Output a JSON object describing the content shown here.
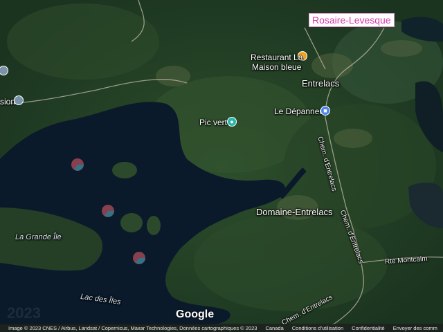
{
  "places": {
    "rosaire": "Rosaire-Levesque",
    "restaurant": "Restaurant La\nMaison bleue",
    "entrelacs": "Entrelacs",
    "depanneur": "Le Dépanneur",
    "picvert": "Pic vert",
    "domaine": "Domaine-Entrelacs",
    "grande_ile": "La Grande Île",
    "lac": "Lac des Îles",
    "sion": "sion"
  },
  "roads": {
    "chem1": "Chem. d'Entrelacs",
    "chem2": "Chem. d'Entrelacs",
    "chem3": "Chem. d'Entrelacs",
    "montcalm": "Rte Montcalm"
  },
  "logo": "Google",
  "footer": {
    "attribution": "Image © 2023 CNES / Airbus, Landsat / Copernicus, Maxar Technologies, Données cartographiques © 2023",
    "country": "Canada",
    "terms": "Conditions d'utilisation",
    "privacy": "Confidentialité",
    "feedback": "Envoyer des comm"
  },
  "icons": {
    "restaurant": "fork-knife-icon",
    "shop": "shopping-bag-icon",
    "park": "camera-icon",
    "generic": "map-pin-icon"
  }
}
